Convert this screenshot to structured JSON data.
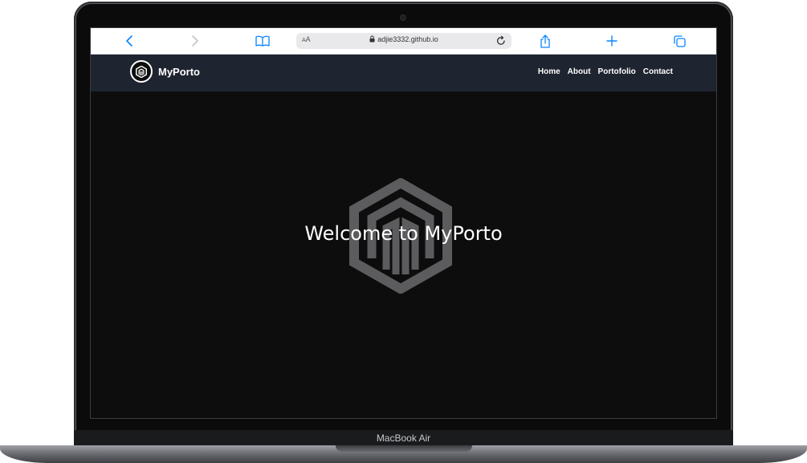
{
  "device": {
    "model_label": "MacBook Air"
  },
  "browser": {
    "aa_label": "AA",
    "url": "adjie3332.github.io",
    "icons": [
      "back-icon",
      "forward-icon",
      "book-icon",
      "lock-icon",
      "reload-icon",
      "share-icon",
      "plus-icon",
      "tabs-icon"
    ],
    "accent_color": "#0a84ff"
  },
  "site": {
    "brand": "MyPorto",
    "nav": [
      {
        "label": "Home"
      },
      {
        "label": "About"
      },
      {
        "label": "Portofolio"
      },
      {
        "label": "Contact"
      }
    ],
    "hero_title": "Welcome to MyPorto",
    "nav_background": "#1e2430",
    "page_background": "#0d0d0e"
  }
}
